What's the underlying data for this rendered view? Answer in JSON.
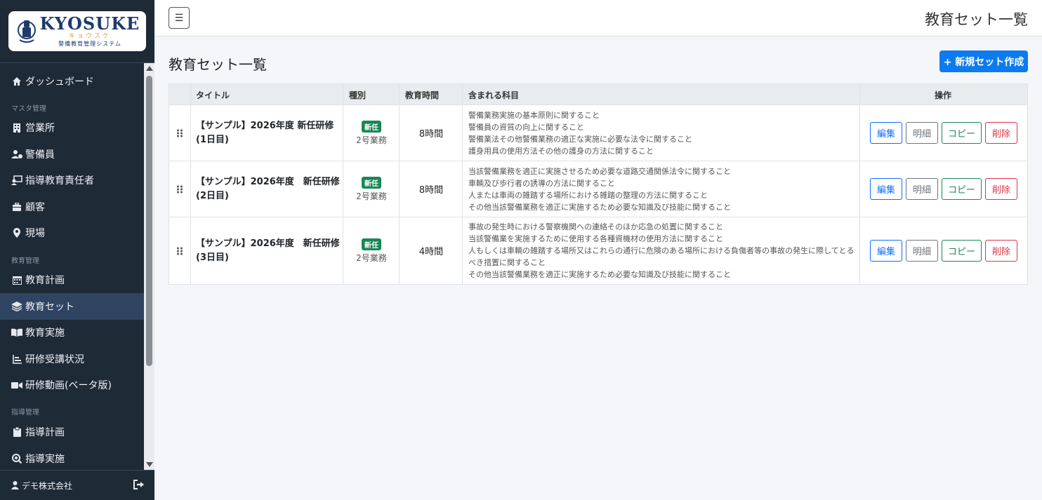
{
  "brand": {
    "title": "KYOSUKE",
    "kana": "キョウスケ",
    "subtitle": "警備教育管理システム"
  },
  "sidebar": {
    "items": [
      {
        "label": "ダッシュボード",
        "icon": "home-icon"
      },
      {
        "section": "マスタ管理"
      },
      {
        "label": "営業所",
        "icon": "building-icon"
      },
      {
        "label": "警備員",
        "icon": "user-check-icon"
      },
      {
        "label": "指導教育責任者",
        "icon": "teacher-icon"
      },
      {
        "label": "顧客",
        "icon": "briefcase-icon"
      },
      {
        "label": "現場",
        "icon": "map-pin-icon"
      },
      {
        "section": "教育管理"
      },
      {
        "label": "教育計画",
        "icon": "calendar-icon"
      },
      {
        "label": "教育セット",
        "icon": "layers-icon",
        "active": true
      },
      {
        "label": "教育実施",
        "icon": "book-open-icon"
      },
      {
        "label": "研修受講状況",
        "icon": "chart-icon"
      },
      {
        "label": "研修動画(ベータ版)",
        "icon": "video-icon"
      },
      {
        "section": "指導管理"
      },
      {
        "label": "指導計画",
        "icon": "clipboard-icon"
      },
      {
        "label": "指導実施",
        "icon": "search-check-icon"
      }
    ],
    "footer_user": "デモ株式会社"
  },
  "header": {
    "menu_icon": "☰",
    "title": "教育セット一覧"
  },
  "main": {
    "title": "教育セット一覧",
    "new_button": "+ 新規セット作成",
    "columns": [
      "タイトル",
      "種別",
      "教育時間",
      "含まれる科目",
      "操作"
    ],
    "rows": [
      {
        "title": "【サンプル】2026年度 新任研修(1日目)",
        "badge": "新任",
        "type": "2号業務",
        "hours": "8時間",
        "subjects": [
          "警備業務実施の基本原則に関すること",
          "警備員の資質の向上に関すること",
          "警備業法その他警備業務の適正な実施に必要な法令に関すること",
          "護身用具の使用方法その他の護身の方法に関すること"
        ]
      },
      {
        "title": "【サンプル】2026年度　新任研修(2日目)",
        "badge": "新任",
        "type": "2号業務",
        "hours": "8時間",
        "subjects": [
          "当該警備業務を適正に実施させるため必要な道路交通関係法令に関すること",
          "車輌及び歩行者の誘導の方法に関すること",
          "人または車両の雑踏する場所における雑踏の整理の方法に関すること",
          "その他当該警備業務を適正に実施するため必要な知識及び技能に関すること"
        ]
      },
      {
        "title": "【サンプル】2026年度　新任研修(3日目)",
        "badge": "新任",
        "type": "2号業務",
        "hours": "4時間",
        "subjects": [
          "事故の発生時における警察機関への連絡そのほか応急の処置に関すること",
          "当該警備業を実施するために使用する各種資機材の使用方法に関すること",
          "人もしくは車輌の雑踏する場所又はこれらの通行に危険のある場所における負傷者等の事故の発生に際してとるべき措置に関すること",
          "その他当該警備業務を適正に実施するため必要な知識及び技能に関すること"
        ]
      }
    ],
    "actions": {
      "edit": "編集",
      "detail": "明細",
      "copy": "コピー",
      "delete": "削除"
    }
  }
}
